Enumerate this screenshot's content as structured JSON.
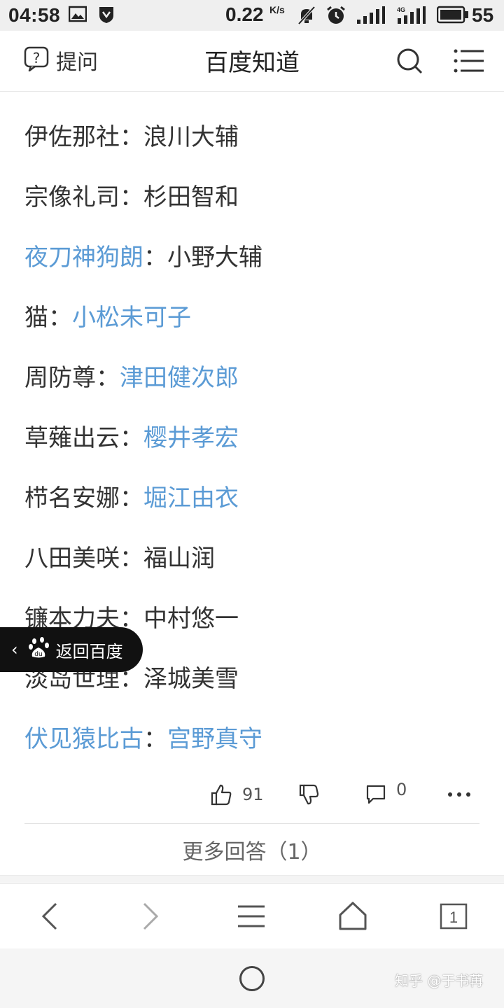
{
  "status_bar": {
    "time": "04:58",
    "speed": "0.22",
    "speed_unit": "K/s",
    "network": "4G",
    "battery": "55"
  },
  "header": {
    "ask_label": "提问",
    "title": "百度知道"
  },
  "answer_lines": [
    {
      "role": "伊佐那社",
      "sep": "：",
      "actor": "浪川大辅",
      "role_link": false,
      "actor_link": false
    },
    {
      "role": "宗像礼司",
      "sep": "：",
      "actor": "杉田智和",
      "role_link": false,
      "actor_link": false
    },
    {
      "role": "夜刀神狗朗",
      "sep": "：",
      "actor": "小野大辅",
      "role_link": true,
      "actor_link": false
    },
    {
      "role": "猫",
      "sep": "：",
      "actor": "小松未可子",
      "role_link": false,
      "actor_link": true
    },
    {
      "role": "周防尊",
      "sep": "：",
      "actor": "津田健次郎",
      "role_link": false,
      "actor_link": true
    },
    {
      "role": "草薙出云",
      "sep": "：",
      "actor": "樱井孝宏",
      "role_link": false,
      "actor_link": true
    },
    {
      "role": "栉名安娜",
      "sep": "：",
      "actor": "堀江由衣",
      "role_link": false,
      "actor_link": true
    },
    {
      "role": "八田美咲",
      "sep": "：",
      "actor": "福山润",
      "role_link": false,
      "actor_link": false
    },
    {
      "role": "镰本力夫",
      "sep": "：",
      "actor": "中村悠一",
      "role_link": false,
      "actor_link": false
    },
    {
      "role": "淡岛世理",
      "sep": "：",
      "actor": "泽城美雪",
      "role_link": false,
      "actor_link": false
    },
    {
      "role": "伏见猿比古",
      "sep": "：",
      "actor": "宫野真守",
      "role_link": true,
      "actor_link": true
    }
  ],
  "actions": {
    "likes": "91",
    "comments": "0"
  },
  "more_answers": "更多回答（1）",
  "back_to_baidu": "返回百度",
  "baidu_logo_text": "du",
  "tabs_count": "1",
  "watermark": "知乎 @于书苒",
  "colors": {
    "link": "#5b9bd5",
    "text": "#333333",
    "pill_bg": "#111111"
  }
}
